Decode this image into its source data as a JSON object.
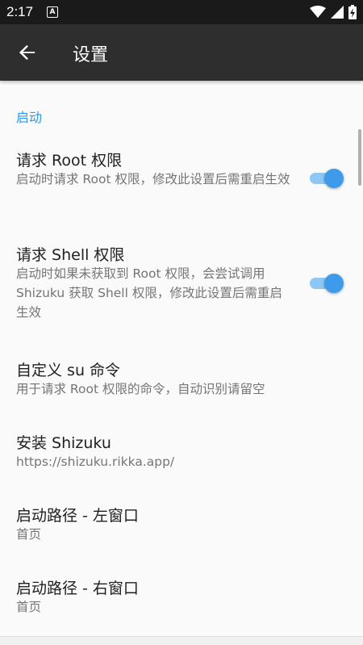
{
  "status_bar": {
    "time": "2:17",
    "notification_badge": "A"
  },
  "app_bar": {
    "title": "设置"
  },
  "section": {
    "header": "启动"
  },
  "prefs": [
    {
      "title": "请求 Root 权限",
      "summary": "启动时请求 Root 权限，修改此设置后需重启生效",
      "switch_on": true
    },
    {
      "title": "请求 Shell 权限",
      "summary": "启动时如果未获取到 Root 权限，会尝试调用 Shizuku 获取 Shell 权限，修改此设置后需重启生效",
      "switch_on": true
    },
    {
      "title": "自定义 su 命令",
      "summary": "用于请求 Root 权限的命令，自动识别请留空"
    },
    {
      "title": "安装 Shizuku",
      "summary": "https://shizuku.rikka.app/"
    },
    {
      "title": "启动路径 - 左窗口",
      "summary": "首页"
    },
    {
      "title": "启动路径 - 右窗口",
      "summary": "首页"
    }
  ],
  "colors": {
    "accent": "#3d9bea",
    "app_bar": "#2e2e2e",
    "status_bar": "#1a1a1a"
  }
}
